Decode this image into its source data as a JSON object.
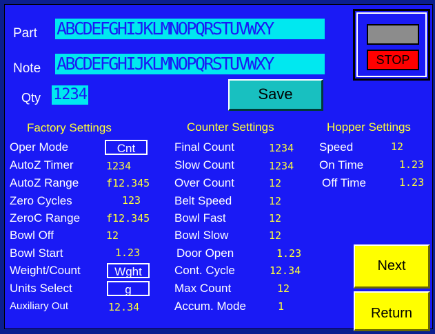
{
  "part": {
    "label": "Part",
    "value": "ABCDEFGHIJKLMNOPQRSTUVWXY"
  },
  "note": {
    "label": "Note",
    "value": "ABCDEFGHIJKLMNOPQRSTUVWXY"
  },
  "qty": {
    "label": "Qty",
    "value": "1234"
  },
  "save_label": "Save",
  "stop_label": "STOP",
  "factory": {
    "title": "Factory Settings",
    "rows": [
      {
        "label": "Oper Mode",
        "value": "Cnt"
      },
      {
        "label": "AutoZ Timer",
        "value": "1234"
      },
      {
        "label": "AutoZ Range",
        "value": "f12.345"
      },
      {
        "label": "Zero Cycles",
        "value": "123"
      },
      {
        "label": "ZeroC Range",
        "value": "f12.345"
      },
      {
        "label": "Bowl Off",
        "value": "12"
      },
      {
        "label": "Bowl Start",
        "value": "1.23"
      },
      {
        "label": "Weight/Count",
        "value": "Wght"
      },
      {
        "label": "Units Select",
        "value": "g"
      },
      {
        "label": "Auxiliary Out",
        "value": "12.34"
      }
    ]
  },
  "counter": {
    "title": "Counter Settings",
    "rows": [
      {
        "label": "Final Count",
        "value": "1234"
      },
      {
        "label": "Slow Count",
        "value": "1234"
      },
      {
        "label": "Over Count",
        "value": "12"
      },
      {
        "label": "Belt Speed",
        "value": "12"
      },
      {
        "label": "Bowl Fast",
        "value": "12"
      },
      {
        "label": "Bowl Slow",
        "value": "12"
      },
      {
        "label": "Door Open",
        "value": "1.23"
      },
      {
        "label": "Cont. Cycle",
        "value": "12.34"
      },
      {
        "label": "Max Count",
        "value": "12"
      },
      {
        "label": "Accum. Mode",
        "value": "1"
      }
    ]
  },
  "hopper": {
    "title": "Hopper Settings",
    "rows": [
      {
        "label": "Speed",
        "value": "12"
      },
      {
        "label": "On Time",
        "value": "1.23"
      },
      {
        "label": "Off Time",
        "value": "1.23"
      }
    ]
  },
  "buttons": {
    "next": "Next",
    "return": "Return"
  },
  "colors": {
    "background": "#1a1af5",
    "field": "#00e8f0",
    "value_text": "#ffff3a",
    "button_yellow": "#ffff00",
    "stop_red": "#ff0000",
    "save_teal": "#18c0c0"
  }
}
